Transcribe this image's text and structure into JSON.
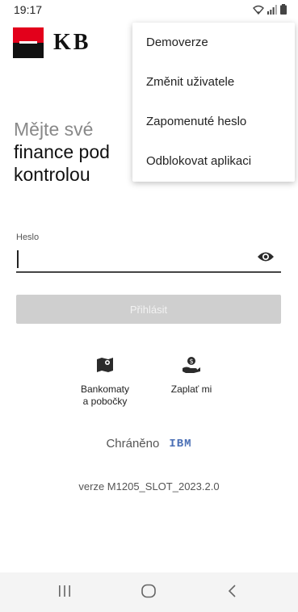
{
  "status_bar": {
    "time": "19:17"
  },
  "brand": {
    "logo_text": "KB"
  },
  "tagline": {
    "line1": "Mějte své",
    "line2": "finance pod",
    "line3": "kontrolou"
  },
  "menu": {
    "items": [
      {
        "label": "Demoverze"
      },
      {
        "label": "Změnit uživatele"
      },
      {
        "label": "Zapomenuté heslo"
      },
      {
        "label": "Odblokovat aplikaci"
      }
    ]
  },
  "password": {
    "label": "Heslo",
    "value": ""
  },
  "login_button": {
    "label": "Přihlásit"
  },
  "shortcuts": [
    {
      "label_line1": "Bankomaty",
      "label_line2": "a pobočky",
      "icon": "map-pin-icon"
    },
    {
      "label_line1": "Zaplať mi",
      "label_line2": "",
      "icon": "hand-money-icon"
    }
  ],
  "footer": {
    "protected_label": "Chráněno",
    "ibm_logo": "IBM",
    "version": "verze M1205_SLOT_2023.2.0"
  },
  "colors": {
    "brand_red": "#e3001b",
    "brand_black": "#111111",
    "disabled_button": "#cfcfcf"
  }
}
